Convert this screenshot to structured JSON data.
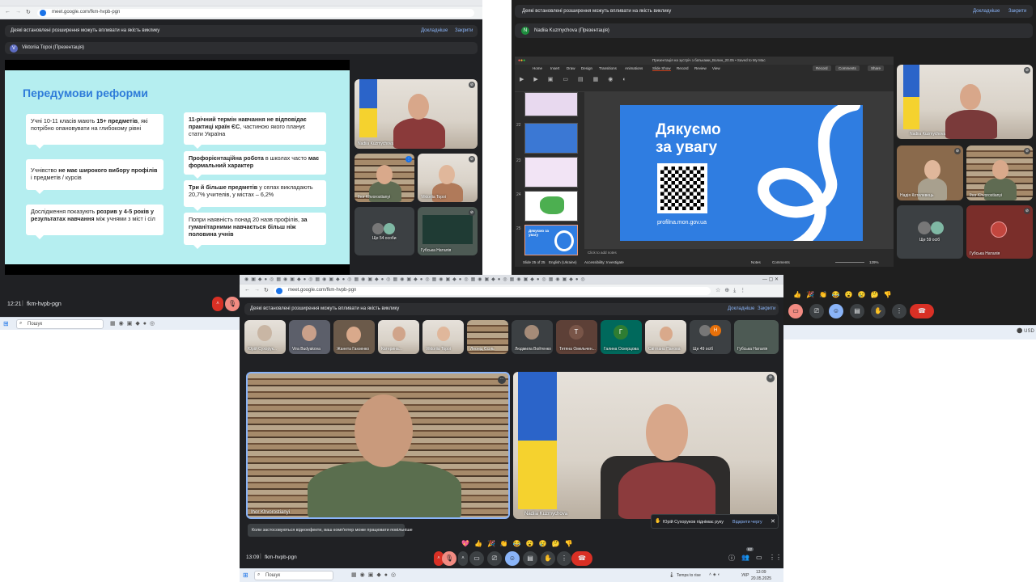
{
  "left_window": {
    "url": "meet.google.com/fkm-hvpb-pgn",
    "banner_text": "Деякі встановлені розширення можуть впливати на якість виклику",
    "banner_details": "Докладніше",
    "banner_close": "Закрити",
    "presenter": "Viktoriia Topoi (Презентація)",
    "presenter_initial": "V",
    "slide": {
      "title": "Передумови реформи",
      "b1_a": "Учні 10-11 класів мають ",
      "b1_b": "15+ предметів",
      "b1_c": ", які потрібно опановувати на глибокому рівні",
      "b2_a": "Учнівство ",
      "b2_b": "не має широкого вибору профілів",
      "b2_c": " і предметів / курсів",
      "b3_a": "Дослідження показують ",
      "b3_b": "розрив у 4-5 років у результатах навчання",
      "b3_c": " між учнями з міст і сіл",
      "b4_a": "11-річний термін навчання не відповідає практиці країн ЄС",
      "b4_b": ", частиною якого планує стати Україна",
      "b5_a": "Профорієнтаційна робота",
      "b5_b": " в школах часто ",
      "b5_c": "має формальний характер",
      "b6_a": "Три й більше предметів",
      "b6_b": " у селах викладають 20,7% учителів, у містах – 6,2%",
      "b7_a": "Попри наявність понад 20 назв профілів, ",
      "b7_b": "за гуманітарними навчається більш ніж половина учнів"
    },
    "tiles": [
      {
        "name": "Nadiia Kuzmychova"
      },
      {
        "name": "Ihor Khvorostianyi"
      },
      {
        "name": "Viktoriia Topoi"
      },
      {
        "name": "Ще 54 особи"
      },
      {
        "name": "Губська Наталія"
      }
    ],
    "time": "12:21",
    "meeting_code": "fkm-hvpb-pgn",
    "search_placeholder": "Пошук"
  },
  "right_window": {
    "banner_text": "Деякі встановлені розширення можуть впливати на якість виклику",
    "banner_details": "Докладніше",
    "banner_close": "Закрити",
    "presenter": "Nadiia Kuzmychova (Презентація)",
    "presenter_initial": "N",
    "ppt_title": "Презентація на зустріч з батьками_Волин_20.05 • Saved to My Mac",
    "ppt_tabs": [
      "Home",
      "Insert",
      "Draw",
      "Design",
      "Transitions",
      "Animations",
      "Slide Show",
      "Record",
      "Review",
      "View"
    ],
    "ppt_record": "Record",
    "ppt_comments": "Comments",
    "ppt_share": "Share",
    "slide_heading_1": "Дякуємо",
    "slide_heading_2": "за увагу",
    "slide_url": "profilna.mon.gov.ua",
    "thumb_numbers": [
      "22",
      "23",
      "24",
      "25"
    ],
    "thumb_25_text": "Дякуємо за увагу",
    "notes_hint": "Click to add notes",
    "status_left": "Slide 25 of 25",
    "status_lang": "English (Ukraine)",
    "status_access": "Accessibility: Investigate",
    "status_notes": "Notes",
    "status_comments": "Comments",
    "zoom": "129%",
    "tiles": [
      {
        "name": "Nadiia Kuzmychova"
      },
      {
        "name": "Надія Котелевець"
      },
      {
        "name": "Ihor Khvorostianyi"
      },
      {
        "name": "Ще 59 осіб"
      },
      {
        "name": "Губська Наталія"
      }
    ],
    "tray": "USD"
  },
  "front_window": {
    "url": "meet.google.com/fkm-hvpb-pgn",
    "banner_text": "Деякі встановлені розширення можуть впливати на якість виклику",
    "banner_details": "Докладніше",
    "banner_close": "Закрити",
    "strip": [
      {
        "name": "Юрій Сухорук..."
      },
      {
        "name": "Vira Budyakova"
      },
      {
        "name": "Жанета Ганзенко"
      },
      {
        "name": "Катерина..."
      },
      {
        "name": "Viktoriia Topoi"
      },
      {
        "name": "Леонід Єсіль"
      },
      {
        "name": "Людмила Войтенко"
      },
      {
        "name": "Тетяна Омельчен...",
        "initial": "Т"
      },
      {
        "name": "Галина Оскерцова",
        "initial": "Г"
      },
      {
        "name": "Світлана Панова"
      },
      {
        "name": "Ще 49 осіб",
        "initial": "Н"
      },
      {
        "name": "Губська Наталія"
      }
    ],
    "main_left_name": "Ihor Khvorostianyi",
    "main_right_name": "Nadiia Kuzmychova",
    "toast_effects": "Коли застосовуються відеоефекти, ваш комп'ютер може працювати повільніше",
    "raise_hand_text": "Юрій Сухоруков піднімає руку",
    "raise_hand_link": "Відкрити чергу",
    "time": "13:09",
    "meeting_code": "fkm-hvpb-pgn",
    "participants_count": "62",
    "search_placeholder": "Пошук",
    "weather": "Temps to rise",
    "lang": "УКР",
    "clock_time": "13:09",
    "clock_date": "20.05.2025"
  },
  "colors": {
    "meet_bg": "#202124",
    "accent": "#8ab4f8",
    "danger": "#d93025",
    "slide_bg": "#b5eef0",
    "slide_title": "#2f7cd9"
  }
}
